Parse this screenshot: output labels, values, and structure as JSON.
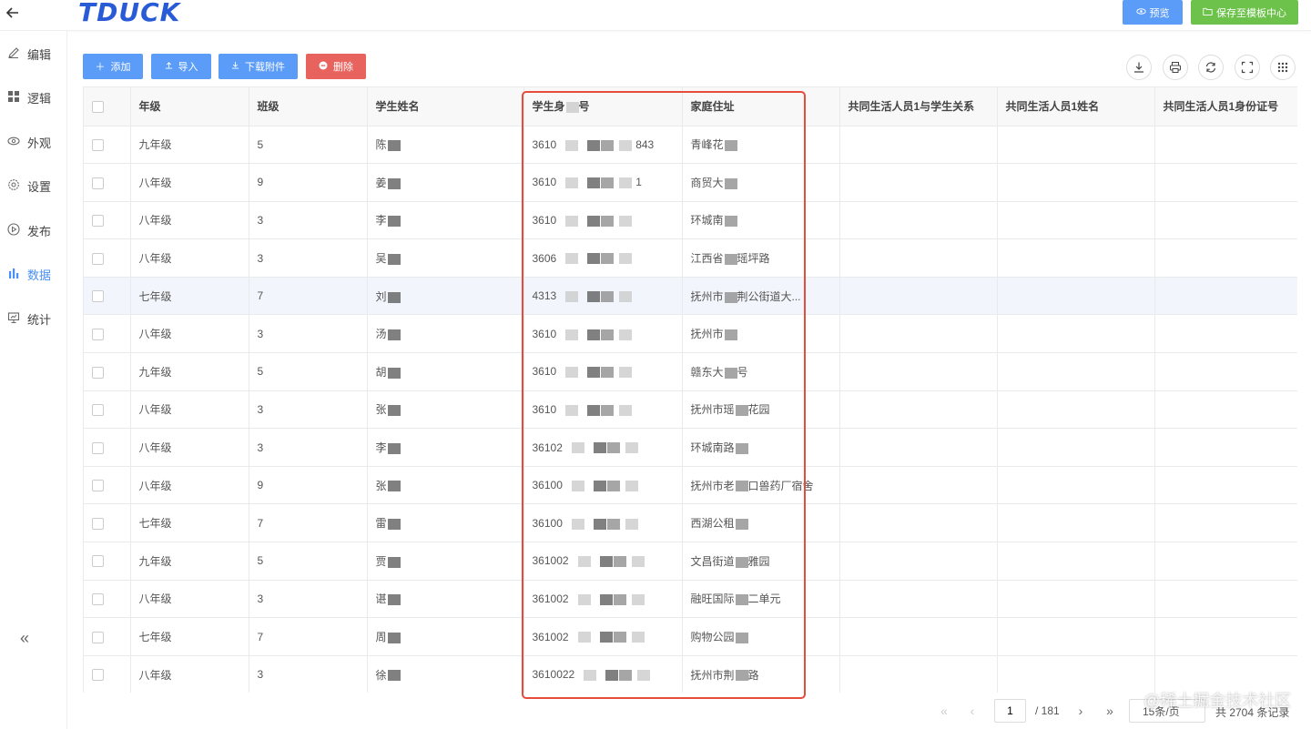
{
  "header": {
    "logo": "TDUCK",
    "preview_label": "预览",
    "save_template_label": "保存至模板中心"
  },
  "sidebar": {
    "items": [
      {
        "label": "编辑",
        "icon": "edit-icon"
      },
      {
        "label": "逻辑",
        "icon": "grid-icon"
      },
      {
        "label": "外观",
        "icon": "eye-icon"
      },
      {
        "label": "设置",
        "icon": "gear-icon"
      },
      {
        "label": "发布",
        "icon": "play-icon"
      },
      {
        "label": "数据",
        "icon": "bar-chart-icon",
        "active": true
      },
      {
        "label": "统计",
        "icon": "presentation-icon"
      }
    ]
  },
  "toolbar": {
    "add_label": "添加",
    "import_label": "导入",
    "download_attach_label": "下载附件",
    "delete_label": "删除"
  },
  "table": {
    "headers": [
      "年级",
      "班级",
      "学生姓名",
      "学生身份证号",
      "家庭住址",
      "共同生活人员1与学生关系",
      "共同生活人员1姓名",
      "共同生活人员1身份证号"
    ],
    "rows": [
      {
        "grade": "九年级",
        "class": "5",
        "name": "陈",
        "id": "3610",
        "id_tail": "843",
        "addr": "青峰花"
      },
      {
        "grade": "八年级",
        "class": "9",
        "name": "姜",
        "id": "3610",
        "id_tail": "1",
        "addr": "商贸大"
      },
      {
        "grade": "八年级",
        "class": "3",
        "name": "李",
        "id": "3610",
        "id_tail": "",
        "addr": "环城南"
      },
      {
        "grade": "八年级",
        "class": "3",
        "name": "吴",
        "id": "3606",
        "id_tail": "",
        "addr": "江西省",
        "addr_tail": "瑶坪路"
      },
      {
        "grade": "七年级",
        "class": "7",
        "name": "刘",
        "id": "4313",
        "id_tail": "",
        "addr": "抚州市",
        "addr_tail": "荆公街道大..."
      },
      {
        "grade": "八年级",
        "class": "3",
        "name": "汤",
        "id": "3610",
        "id_tail": "",
        "addr": "抚州市"
      },
      {
        "grade": "九年级",
        "class": "5",
        "name": "胡",
        "id": "3610",
        "id_tail": "",
        "addr": "赣东大",
        "addr_tail": "号"
      },
      {
        "grade": "八年级",
        "class": "3",
        "name": "张",
        "id": "3610",
        "id_tail": "",
        "addr": "抚州市瑶",
        "addr_tail": "花园"
      },
      {
        "grade": "八年级",
        "class": "3",
        "name": "李",
        "id": "36102",
        "id_tail": "",
        "addr": "环城南路"
      },
      {
        "grade": "八年级",
        "class": "9",
        "name": "张",
        "id": "36100",
        "id_tail": "",
        "addr": "抚州市老",
        "addr_tail": "口兽药厂宿舍"
      },
      {
        "grade": "七年级",
        "class": "7",
        "name": "雷",
        "id": "36100",
        "id_tail": "",
        "addr": "西湖公租"
      },
      {
        "grade": "九年级",
        "class": "5",
        "name": "贾",
        "id": "361002",
        "id_tail": "",
        "addr": "文昌街道",
        "addr_tail": "雅园"
      },
      {
        "grade": "八年级",
        "class": "3",
        "name": "谌",
        "id": "361002",
        "id_tail": "",
        "addr": "融旺国际",
        "addr_tail": "二单元"
      },
      {
        "grade": "七年级",
        "class": "7",
        "name": "周",
        "id": "361002",
        "id_tail": "",
        "addr": "购物公园"
      },
      {
        "grade": "八年级",
        "class": "3",
        "name": "徐",
        "id": "3610022",
        "id_tail": "",
        "addr": "抚州市荆",
        "addr_tail": "路"
      }
    ]
  },
  "pagination": {
    "current_page": "1",
    "total_pages": "/ 181",
    "page_size": "15条/页",
    "total_records": "共 2704 条记录"
  },
  "watermark": "@稀土掘金技术社区",
  "colors": {
    "primary": "#5b9cf8",
    "success": "#6cc24a",
    "danger": "#e8635e",
    "highlight_box": "#e64b3c",
    "logo": "#2a5bd7"
  }
}
